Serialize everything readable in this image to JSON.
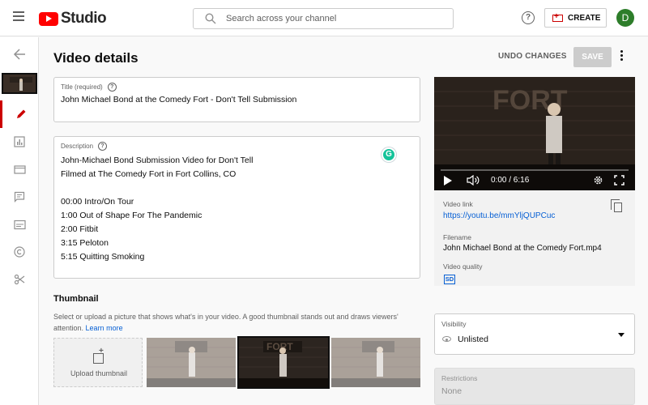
{
  "app": {
    "logo_text": "Studio"
  },
  "search": {
    "placeholder": "Search across your channel"
  },
  "header": {
    "help": "?",
    "create_label": "CREATE",
    "avatar_initial": "D"
  },
  "page": {
    "title": "Video details",
    "undo_label": "UNDO CHANGES",
    "save_label": "SAVE"
  },
  "title_field": {
    "label": "Title (required)",
    "value": "John Michael Bond at the Comedy Fort - Don't Tell Submission"
  },
  "description_field": {
    "label": "Description",
    "lines": [
      "John-Michael Bond Submission Video for Don't Tell",
      "Filmed at The Comedy Fort in Fort Collins, CO",
      "",
      "00:00 Intro/On Tour",
      "1:00 Out of Shape For The Pandemic",
      "2:00 Fitbit",
      "3:15 Peloton",
      "5:15 Quitting Smoking"
    ]
  },
  "grammarly": {
    "letter": "G"
  },
  "thumbnail": {
    "heading": "Thumbnail",
    "description": "Select or upload a picture that shows what's in your video. A good thumbnail stands out and draws viewers' attention.",
    "learn_more": "Learn more",
    "upload_label": "Upload thumbnail",
    "selected_index": 1
  },
  "player": {
    "time": "0:00 / 6:16",
    "sign_text": "FORT"
  },
  "video_info": {
    "link_label": "Video link",
    "link_value": "https://youtu.be/mmYljQUPCuc",
    "filename_label": "Filename",
    "filename_value": "John Michael Bond at the Comedy Fort.mp4",
    "quality_label": "Video quality",
    "quality_badge": "SD"
  },
  "visibility": {
    "label": "Visibility",
    "value": "Unlisted"
  },
  "restrictions": {
    "label": "Restrictions",
    "value": "None"
  },
  "colors": {
    "brand_red": "#ff0000",
    "link_blue": "#065fd4",
    "avatar_green": "#2d7d2a",
    "grammarly_green": "#15c39a"
  }
}
